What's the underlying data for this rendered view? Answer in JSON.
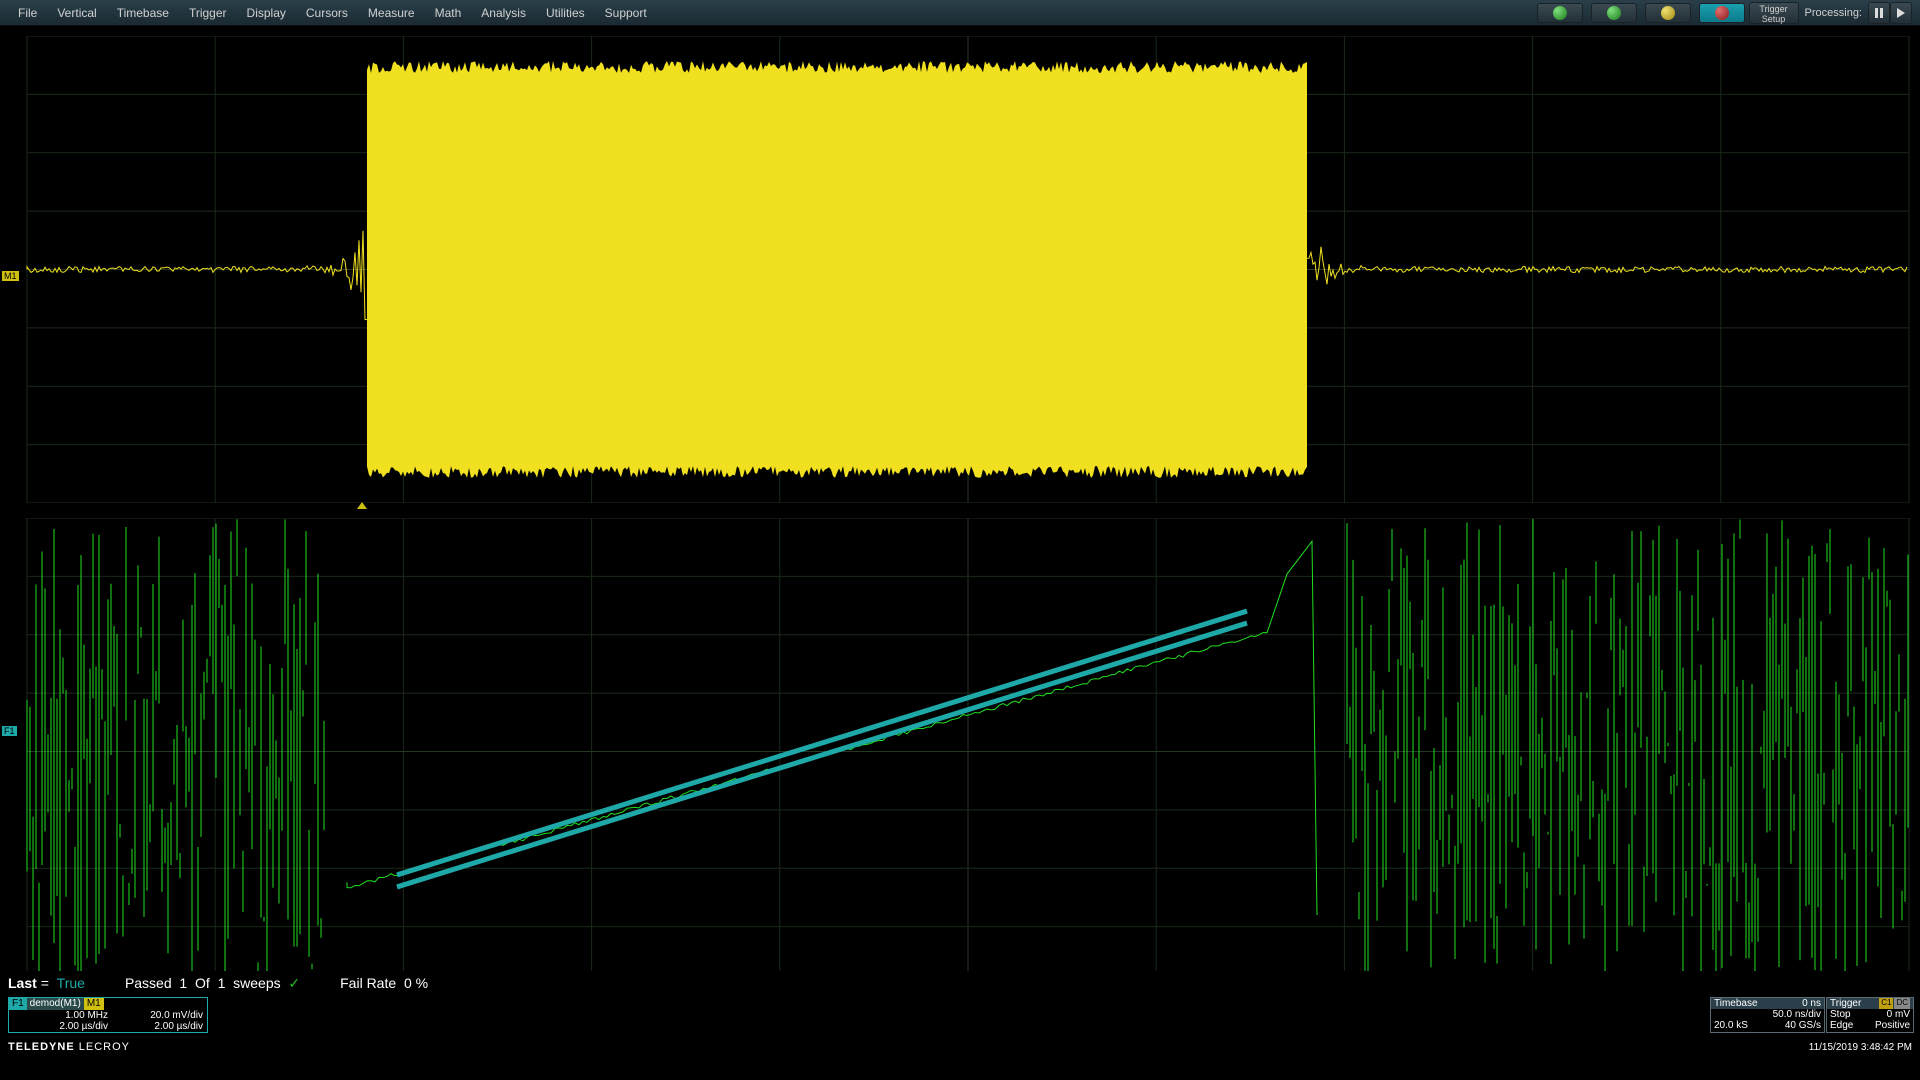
{
  "menu": {
    "items": [
      "File",
      "Vertical",
      "Timebase",
      "Trigger",
      "Display",
      "Cursors",
      "Measure",
      "Math",
      "Analysis",
      "Utilities",
      "Support"
    ]
  },
  "toolbar": {
    "trigger_setup_l1": "Trigger",
    "trigger_setup_l2": "Setup",
    "processing_label": "Processing:"
  },
  "trace_labels": {
    "m1": "M1",
    "f1": "F1"
  },
  "test_results": {
    "last_lbl": "Last",
    "last_eq": "=",
    "last_val": "True",
    "passed_lbl": "Passed",
    "passed_n": "1",
    "of_lbl": "Of",
    "total_n": "1",
    "sweeps_lbl": "sweeps",
    "failrate_lbl": "Fail Rate",
    "failrate_val": "0 %"
  },
  "channel": {
    "f1_tab": "F1",
    "demod_tab": "demod(M1)",
    "m1_tab": "M1",
    "freq": "1.00 MHz",
    "timediv1": "2.00 µs/div",
    "vdiv": "20.0 mV/div",
    "timediv2": "2.00 µs/div"
  },
  "timebase": {
    "title": "Timebase",
    "delay": "0 ns",
    "tdiv": "50.0 ns/div",
    "samples": "20.0 kS",
    "rate": "40 GS/s"
  },
  "trigger": {
    "title": "Trigger",
    "mode": "Stop",
    "level": "0 mV",
    "type": "Edge",
    "slope": "Positive",
    "badge1": "C1",
    "badge2": "DC"
  },
  "brand": {
    "a": "TELEDYNE",
    "b": " LECROY"
  },
  "timestamp": "11/15/2019 3:48:42 PM"
}
